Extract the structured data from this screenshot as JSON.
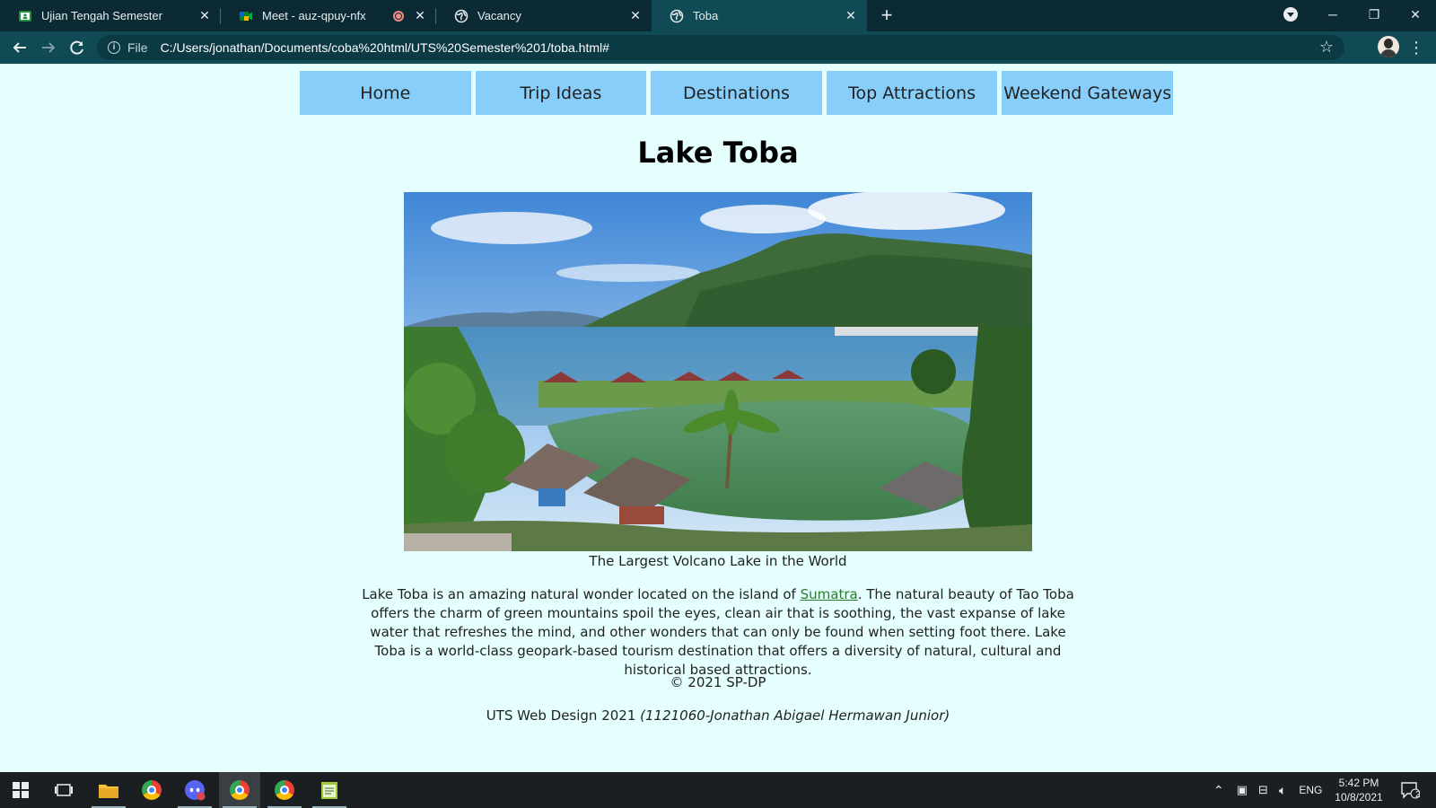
{
  "browser": {
    "tabs": [
      {
        "title": "Ujian Tengah Semester",
        "icon": "classroom-icon"
      },
      {
        "title": "Meet - auz-qpuy-nfx",
        "icon": "meet-icon",
        "recording": true
      },
      {
        "title": "Vacancy",
        "icon": "globe-icon"
      },
      {
        "title": "Toba",
        "icon": "globe-icon",
        "active": true
      }
    ],
    "omnibox": {
      "scheme_label": "File",
      "url": "C:/Users/jonathan/Documents/coba%20html/UTS%20Semester%201/toba.html#"
    }
  },
  "page": {
    "nav": [
      {
        "label": "Home"
      },
      {
        "label": "Trip Ideas"
      },
      {
        "label": "Destinations"
      },
      {
        "label": "Top Attractions"
      },
      {
        "label": "Weekend Gateways"
      }
    ],
    "title": "Lake Toba",
    "caption": "The Largest Volcano Lake in the World",
    "desc_before": "Lake Toba is an amazing natural wonder located on the island of ",
    "desc_link": "Sumatra",
    "desc_after": ". The natural beauty of Tao Toba offers the charm of green mountains spoil the eyes, clean air that is soothing, the vast expanse of lake water that refreshes the mind, and other wonders that can only be found when setting foot there. Lake Toba is a world-class geopark-based tourism destination that offers a diversity of natural, cultural and historical based attractions.",
    "copyright": "© 2021 SP-DP",
    "credit_prefix": "UTS Web Design 2021 ",
    "credit_name": "(1121060-Jonathan Abigael Hermawan Junior)"
  },
  "taskbar": {
    "language": "ENG",
    "time": "5:42 PM",
    "date": "10/8/2021",
    "notifications": "2"
  },
  "colors": {
    "page_bg": "#e5ffff",
    "nav_bg": "#87cefa",
    "link": "#2a7d2a",
    "tabstrip_bg": "#0b2a34",
    "toolbar_bg": "#0f4a55"
  }
}
